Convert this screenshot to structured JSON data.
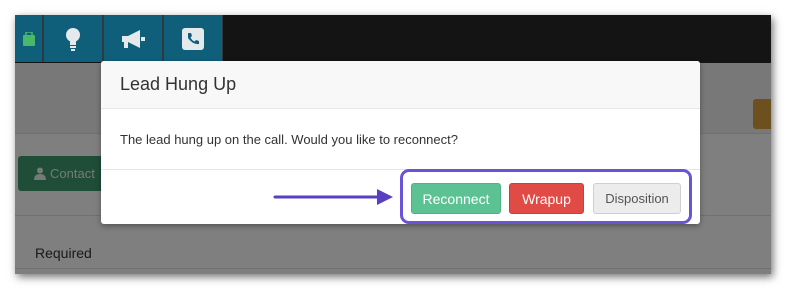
{
  "topbar": {
    "icons": [
      "briefcase-icon",
      "lightbulb-icon",
      "megaphone-icon",
      "phone-icon"
    ]
  },
  "page": {
    "contact_tab_label": "Contact",
    "required_label": "Required"
  },
  "modal": {
    "title": "Lead Hung Up",
    "message": "The lead hung up on the call. Would you like to reconnect?",
    "buttons": {
      "reconnect": "Reconnect",
      "wrapup": "Wrapup",
      "disposition": "Disposition"
    }
  },
  "colors": {
    "reconnect": "#5cc293",
    "wrapup": "#e04b46",
    "disposition": "#ececec",
    "highlight": "#6b53d6",
    "topbar_button": "#0f5f7a"
  }
}
